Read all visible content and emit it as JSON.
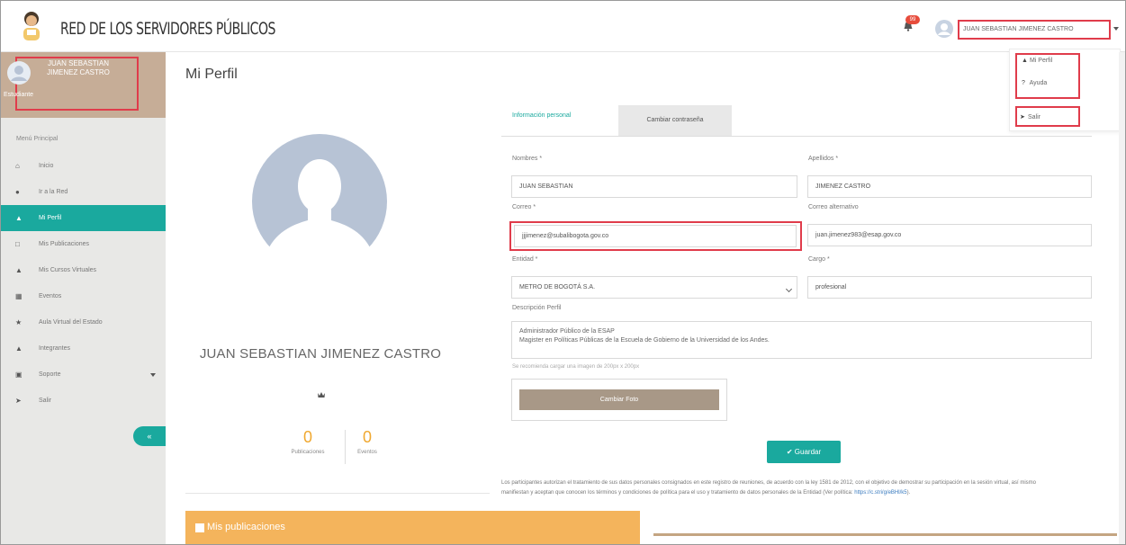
{
  "header": {
    "app_title": "RED DE LOS SERVIDORES PÚBLICOS",
    "notification_count": "99",
    "user_menu_label": "JUAN SEBASTIAN JIMENEZ CASTRO"
  },
  "user_dropdown": {
    "items": [
      {
        "label": "Mi Perfil",
        "icon": "user-icon"
      },
      {
        "label": "Ayuda",
        "icon": "help-icon"
      }
    ],
    "exit_label": "Salir"
  },
  "sidebar": {
    "user_name": "JUAN SEBASTIAN JIMENEZ CASTRO",
    "role": "Estudiante",
    "menu_heading": "Menú Principal",
    "items": [
      {
        "label": "Inicio",
        "icon": "home-icon"
      },
      {
        "label": "Ir a la Red",
        "icon": "globe-icon"
      },
      {
        "label": "Mi Perfil",
        "icon": "user-icon",
        "active": true
      },
      {
        "label": "Mis Publicaciones",
        "icon": "document-icon"
      },
      {
        "label": "Mis Cursos Virtuales",
        "icon": "graduation-cap-icon"
      },
      {
        "label": "Eventos",
        "icon": "calendar-icon"
      },
      {
        "label": "Aula Virtual del Estado",
        "icon": "star-icon"
      },
      {
        "label": "Integrantes",
        "icon": "users-icon"
      },
      {
        "label": "Soporte",
        "icon": "support-icon"
      },
      {
        "label": "Salir",
        "icon": "sign-out-icon"
      }
    ],
    "collapse_symbol": "«"
  },
  "main": {
    "page_title": "Mi Perfil",
    "profile_name": "JUAN SEBASTIAN JIMENEZ CASTRO",
    "stats": [
      {
        "value": "0",
        "label": "Publicaciones"
      },
      {
        "value": "0",
        "label": "Eventos"
      }
    ],
    "publications_title": "Mis publicaciones"
  },
  "tabs": {
    "personal": "Información personal",
    "password": "Cambiar contraseña"
  },
  "form": {
    "first_name_label": "Nombres *",
    "first_name_value": "JUAN SEBASTIAN",
    "last_name_label": "Apellidos *",
    "last_name_value": "JIMENEZ CASTRO",
    "email_label": "Correo *",
    "email_value": "jjjimenez@subalibogota.gov.co",
    "alt_email_label": "Correo alternativo",
    "alt_email_value": "juan.jimenez983@esap.gov.co",
    "entity_label": "Entidad *",
    "entity_value": "METRO DE BOGOTÁ S.A.",
    "position_label": "Cargo *",
    "position_value": "profesional",
    "description_label": "Descripción Perfil",
    "description_line1": "Administrador Público de la ESAP",
    "description_line2": "Magister en Políticas Públicas de la Escuela de Gobierno de la Universidad de los Andes.",
    "photo_hint": "Se recomienda cargar una imagen de 200px x 200px",
    "change_photo": "Cambiar Foto",
    "save": "Guardar",
    "consent_text": "Los participantes autorizan el tratamiento de sus datos personales consignados en este registro de reuniones, de acuerdo con la ley 1581 de 2012, con el objetivo de demostrar su participación en la sesión virtual, así mismo manifiestan y aceptan que conocen los términos y condiciones de política para el uso y tratamiento de datos personales de la Entidad (Ver política:",
    "consent_link": "https://c.stri/g/eBHl/k5",
    "consent_close": ")."
  },
  "colors": {
    "accent": "#1aa99e",
    "sidebar_profile": "#c6ad97",
    "publications_header": "#f4b45c",
    "stat_number": "#f0a830",
    "highlight_box": "#e03c4b"
  }
}
